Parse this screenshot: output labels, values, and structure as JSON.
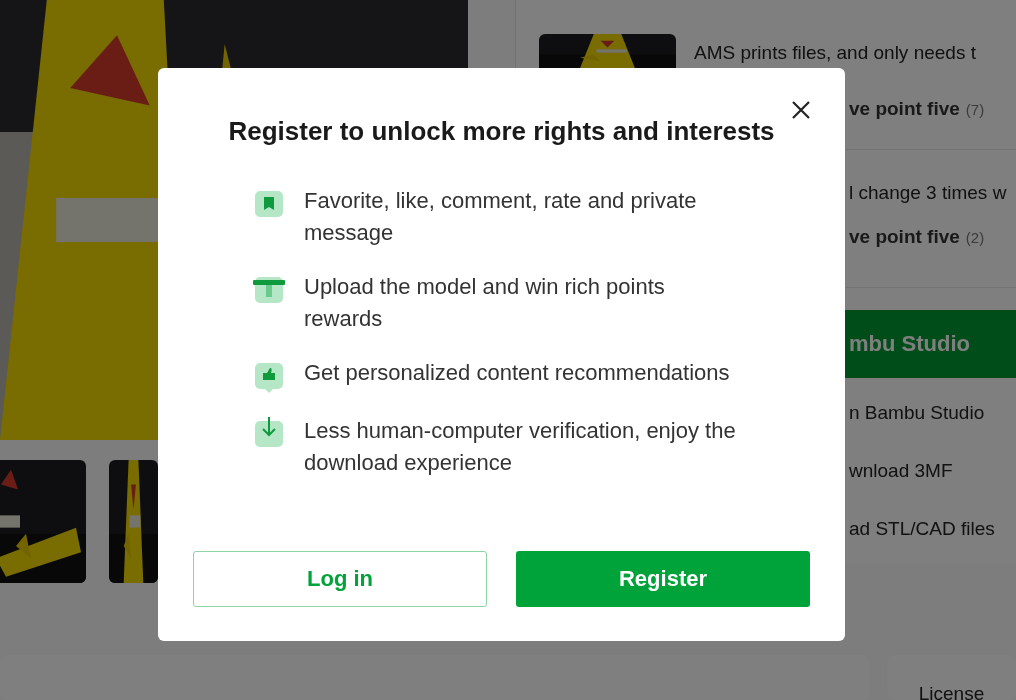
{
  "page": {
    "models": [
      {
        "title": "AMS prints files, and only needs t",
        "author": "ve point five",
        "count": "(7)"
      },
      {
        "title": "l change 3 times w",
        "author": "ve point five",
        "count": "(2)"
      }
    ],
    "primary_action": "mbu Studio",
    "actions": [
      "n Bambu Studio",
      "wnload 3MF",
      "ad STL/CAD files"
    ],
    "side_tab": "License"
  },
  "dialog": {
    "title": "Register to unlock more rights and interests",
    "benefits": [
      {
        "kind": "bookmark",
        "text": "Favorite, like, comment, rate and private message"
      },
      {
        "kind": "gift",
        "text": "Upload the model and win rich points rewards"
      },
      {
        "kind": "thumb",
        "text": "Get personalized content recommendations"
      },
      {
        "kind": "download",
        "text": "Less human-computer verification, enjoy the download experience"
      }
    ],
    "buttons": [
      {
        "kind": "outline",
        "label": "Log in"
      },
      {
        "kind": "filled",
        "label": "Register"
      }
    ]
  }
}
